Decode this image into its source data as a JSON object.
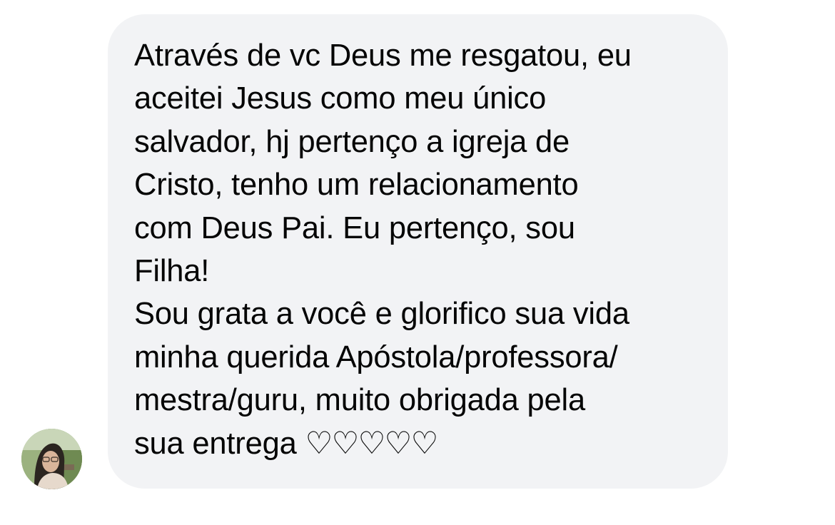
{
  "message": {
    "lines": [
      "Através de vc Deus me resgatou, eu",
      "aceitei Jesus como meu único",
      "salvador, hj pertenço a igreja de",
      "Cristo, tenho um relacionamento",
      "com Deus Pai. Eu pertenço, sou",
      "Filha!",
      "Sou grata a você e glorifico sua vida",
      "minha querida Apóstola/professora/",
      "mestra/guru, muito obrigada pela"
    ],
    "last_line_text": "sua entrega ",
    "hearts": "♡♡♡♡♡"
  },
  "colors": {
    "bubble_background": "#f2f3f5",
    "text": "#050505",
    "page_background": "#ffffff"
  },
  "icons": {
    "avatar": "sender-avatar-photo"
  }
}
